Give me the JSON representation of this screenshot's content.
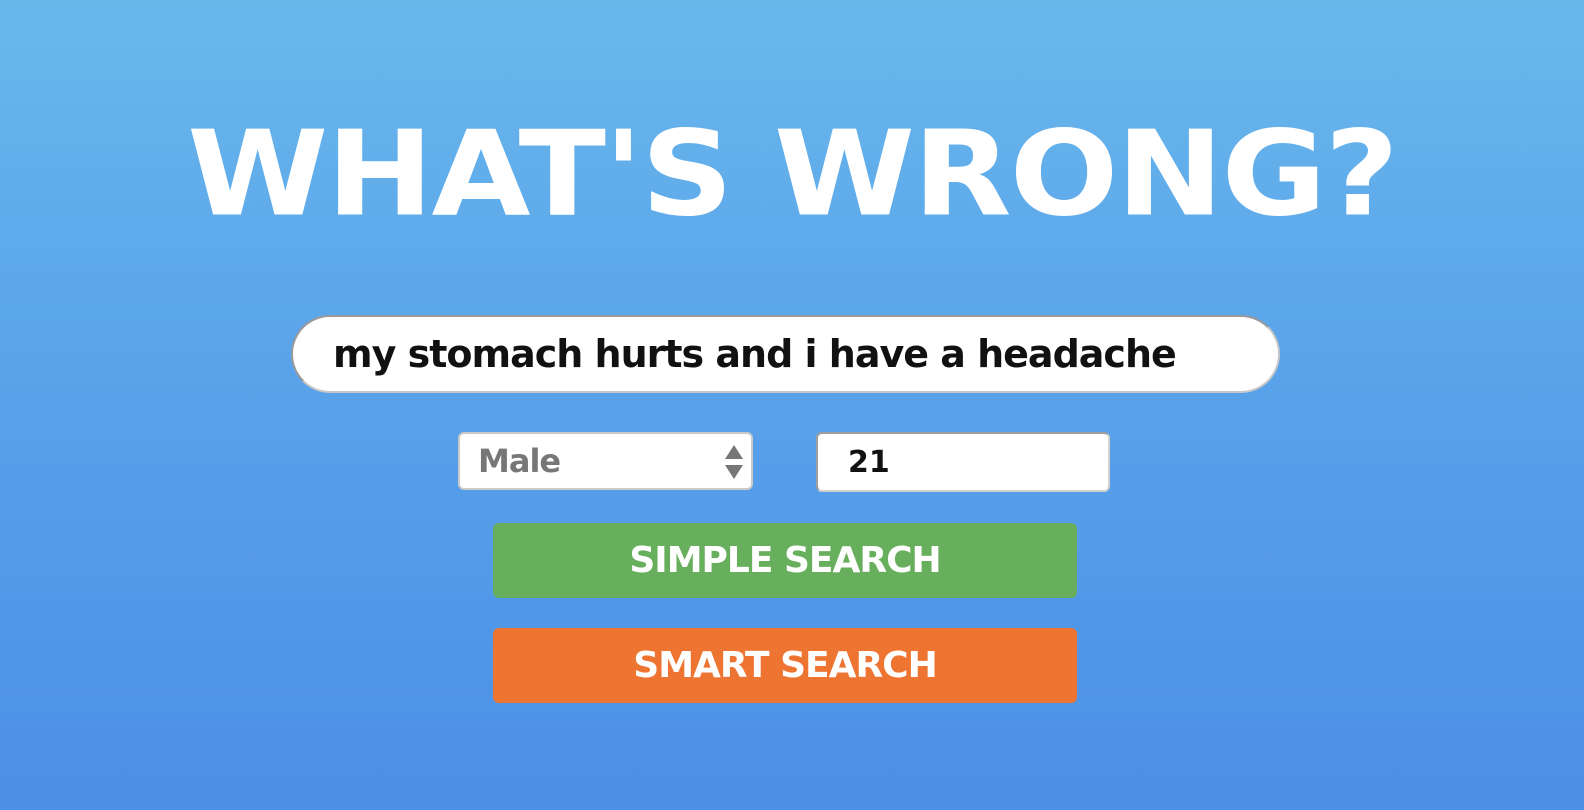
{
  "page": {
    "title": "WHAT'S WRONG?"
  },
  "search": {
    "query_value": "my stomach hurts and i have a headache"
  },
  "sex_select": {
    "selected": "Male"
  },
  "age_field": {
    "value": "21"
  },
  "buttons": {
    "simple_search": "SIMPLE SEARCH",
    "smart_search": "SMART SEARCH"
  },
  "colors": {
    "background_top": "#69b8ec",
    "background_bottom": "#4b8fe6",
    "simple_button": "#68af5d",
    "smart_button": "#ee7431",
    "title_text": "#ffffff"
  },
  "icons": {
    "select_stepper": "up-down-stepper-icon"
  }
}
